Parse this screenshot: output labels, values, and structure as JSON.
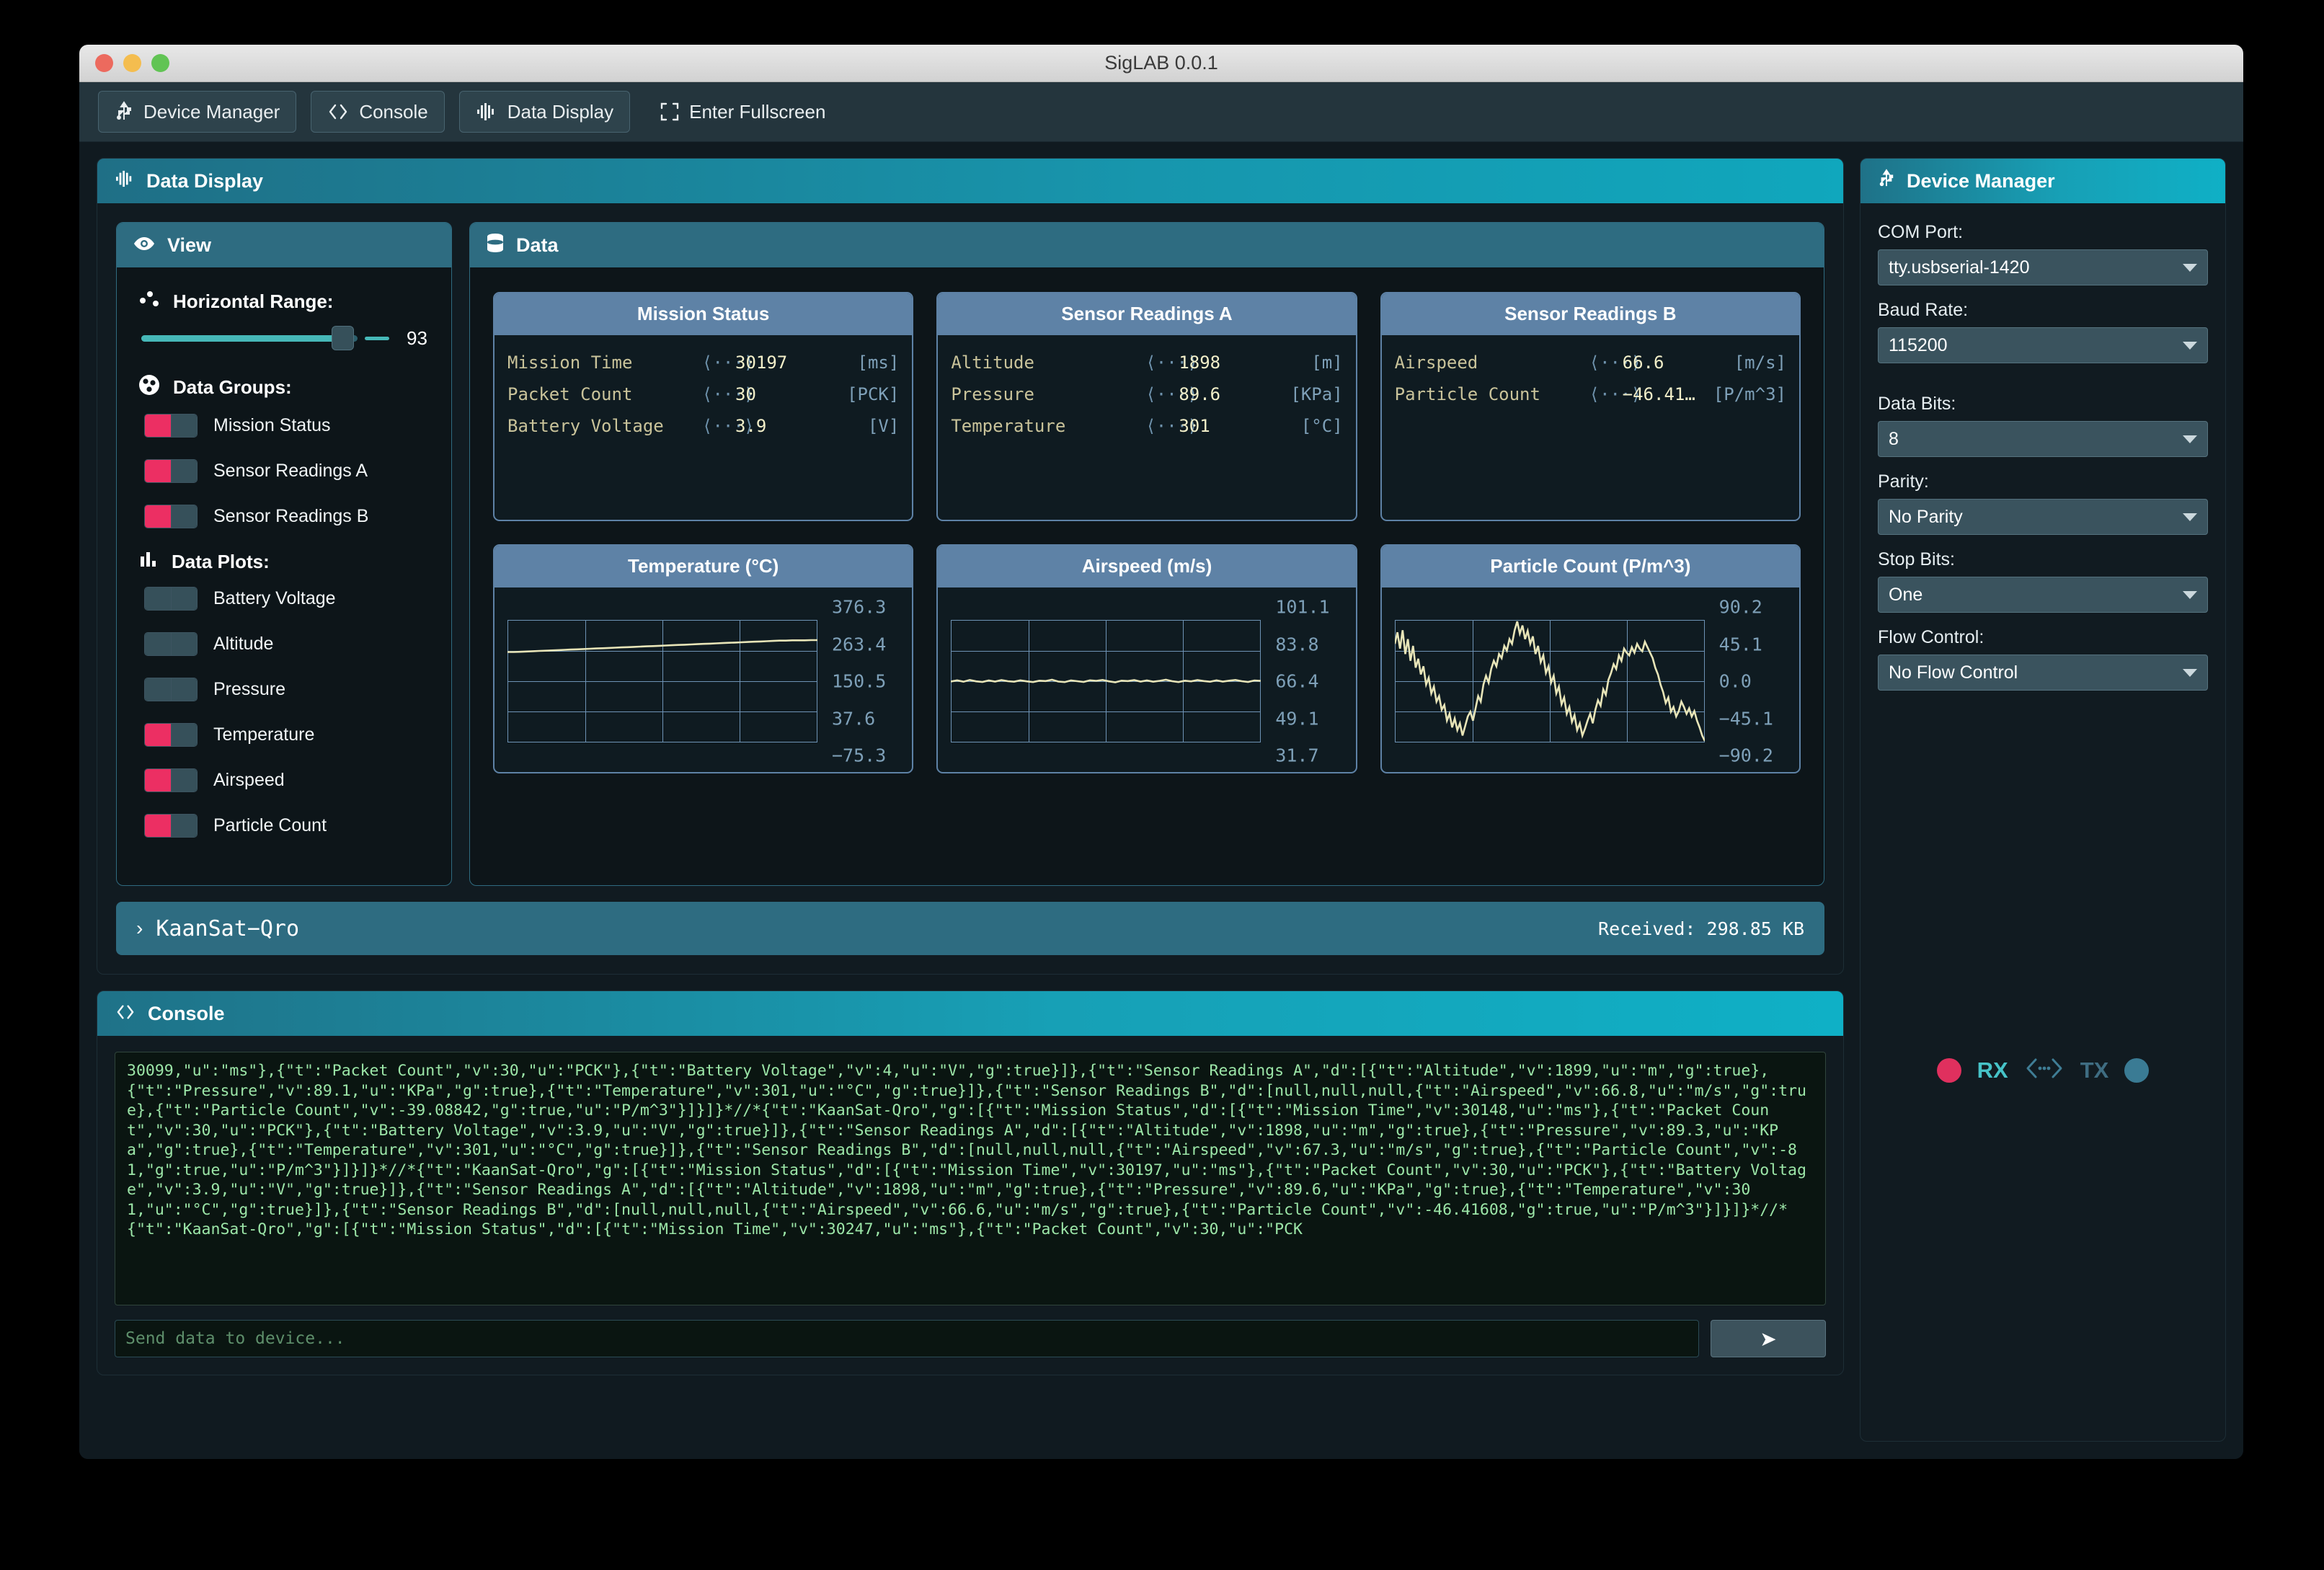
{
  "window": {
    "title": "SigLAB 0.0.1"
  },
  "toolbar": {
    "device_manager": "Device Manager",
    "console": "Console",
    "data_display": "Data Display",
    "fullscreen": "Enter Fullscreen"
  },
  "data_display": {
    "header": "Data Display",
    "view": {
      "header": "View",
      "horizontal_range_label": "Horizontal Range:",
      "horizontal_range_value": "93",
      "data_groups_label": "Data Groups:",
      "groups": [
        {
          "label": "Mission Status",
          "state": "on"
        },
        {
          "label": "Sensor Readings A",
          "state": "on"
        },
        {
          "label": "Sensor Readings B",
          "state": "on"
        }
      ],
      "data_plots_label": "Data Plots:",
      "plots": [
        {
          "label": "Battery Voltage",
          "state": "off"
        },
        {
          "label": "Altitude",
          "state": "off"
        },
        {
          "label": "Pressure",
          "state": "off"
        },
        {
          "label": "Temperature",
          "state": "on"
        },
        {
          "label": "Airspeed",
          "state": "on"
        },
        {
          "label": "Particle Count",
          "state": "on"
        }
      ]
    },
    "data": {
      "header": "Data",
      "cards": [
        {
          "title": "Mission Status",
          "rows": [
            {
              "key": "Mission Time   ",
              "value": "30197",
              "unit": "[ms]"
            },
            {
              "key": "Packet Count   ",
              "value": "30",
              "unit": "[PCK]"
            },
            {
              "key": "Battery Voltage",
              "value": "3.9",
              "unit": "[V]"
            }
          ]
        },
        {
          "title": "Sensor Readings A",
          "rows": [
            {
              "key": "Altitude   ",
              "value": "1898",
              "unit": "[m]"
            },
            {
              "key": "Pressure   ",
              "value": "89.6",
              "unit": "[KPa]"
            },
            {
              "key": "Temperature",
              "value": "301",
              "unit": "[°C]"
            }
          ]
        },
        {
          "title": "Sensor Readings B",
          "rows": [
            {
              "key": "Airspeed      ",
              "value": "66.6",
              "unit": "[m/s]"
            },
            {
              "key": "Particle Count",
              "value": "−46.41…",
              "unit": "[P/m^3]"
            }
          ]
        }
      ]
    }
  },
  "chart_data": [
    {
      "type": "line",
      "title": "Temperature (°C)",
      "ylabel": "",
      "xlabel": "",
      "grid": true,
      "yticks": [
        "376.3",
        "263.4",
        "150.5",
        "37.6",
        "−75.3"
      ],
      "ylim": [
        -75.3,
        376.3
      ],
      "values": [
        258,
        258,
        259,
        260,
        261,
        262,
        263,
        264,
        265,
        266,
        267,
        268,
        269,
        270,
        271,
        272,
        273,
        274,
        275,
        276,
        277,
        278,
        279,
        280,
        281,
        282,
        283,
        284,
        285,
        286,
        287,
        288,
        289,
        290,
        291,
        292,
        293,
        294,
        295,
        296,
        297,
        298,
        299,
        300,
        300,
        301,
        301,
        301,
        302,
        302
      ]
    },
    {
      "type": "line",
      "title": "Airspeed (m/s)",
      "ylabel": "",
      "xlabel": "",
      "grid": true,
      "yticks": [
        "101.1",
        "83.8",
        "66.4",
        "49.1",
        "31.7"
      ],
      "ylim": [
        31.7,
        101.1
      ],
      "values": [
        66.2,
        66.9,
        66.1,
        67.1,
        66.3,
        66.0,
        66.8,
        66.2,
        67.0,
        66.4,
        66.1,
        66.9,
        66.3,
        65.9,
        66.7,
        66.5,
        67.2,
        66.2,
        65.9,
        66.8,
        66.4,
        66.0,
        66.9,
        66.6,
        67.1,
        66.3,
        65.8,
        66.7,
        66.5,
        67.0,
        66.2,
        66.8,
        66.1,
        66.6,
        67.2,
        66.4,
        65.9,
        66.7,
        66.3,
        67.0,
        66.5,
        66.1,
        66.9,
        66.2,
        66.7,
        67.1,
        66.4,
        66.0,
        66.8,
        66.6
      ]
    },
    {
      "type": "line",
      "title": "Particle Count (P/m^3)",
      "ylabel": "",
      "xlabel": "",
      "grid": true,
      "yticks": [
        "90.2",
        "45.1",
        "0.0",
        "−45.1",
        "−90.2"
      ],
      "ylim": [
        -90.2,
        90.2
      ],
      "values": [
        55,
        72,
        48,
        75,
        40,
        62,
        30,
        52,
        20,
        33,
        10,
        22,
        -5,
        5,
        -18,
        -8,
        -30,
        -22,
        -42,
        -35,
        -58,
        -48,
        -68,
        -55,
        -72,
        -62,
        -80,
        -66,
        -52,
        -45,
        -58,
        -40,
        -22,
        -30,
        -5,
        8,
        -2,
        18,
        30,
        22,
        40,
        34,
        52,
        45,
        62,
        55,
        75,
        88,
        70,
        82,
        62,
        74,
        55,
        66,
        40,
        52,
        28,
        38,
        12,
        22,
        -2,
        8,
        -18,
        -8,
        -34,
        -24,
        -48,
        -38,
        -60,
        -50,
        -72,
        -62,
        -80,
        -70,
        -58,
        -48,
        -62,
        -42,
        -28,
        -36,
        -12,
        -20,
        2,
        12,
        25,
        18,
        38,
        30,
        48,
        42,
        38,
        50,
        42,
        55,
        48,
        44,
        58,
        50,
        42,
        34,
        20,
        10,
        -5,
        -16,
        -32,
        -24,
        -45,
        -38,
        -52,
        -44,
        -30,
        -38,
        -48,
        -40,
        -52,
        -44,
        -58,
        -68,
        -80,
        -88
      ]
    }
  ],
  "device_bar": {
    "name": "KaanSat−Qro",
    "received": "Received: 298.85 KB",
    "chevron": "›"
  },
  "console": {
    "header": "Console",
    "output": "30099,\"u\":\"ms\"},{\"t\":\"Packet Count\",\"v\":30,\"u\":\"PCK\"},{\"t\":\"Battery Voltage\",\"v\":4,\"u\":\"V\",\"g\":true}]},{\"t\":\"Sensor Readings A\",\"d\":[{\"t\":\"Altitude\",\"v\":1899,\"u\":\"m\",\"g\":true},{\"t\":\"Pressure\",\"v\":89.1,\"u\":\"KPa\",\"g\":true},{\"t\":\"Temperature\",\"v\":301,\"u\":\"°C\",\"g\":true}]},{\"t\":\"Sensor Readings B\",\"d\":[null,null,null,{\"t\":\"Airspeed\",\"v\":66.8,\"u\":\"m/s\",\"g\":true},{\"t\":\"Particle Count\",\"v\":-39.08842,\"g\":true,\"u\":\"P/m^3\"}]}]}*//*{\"t\":\"KaanSat-Qro\",\"g\":[{\"t\":\"Mission Status\",\"d\":[{\"t\":\"Mission Time\",\"v\":30148,\"u\":\"ms\"},{\"t\":\"Packet Count\",\"v\":30,\"u\":\"PCK\"},{\"t\":\"Battery Voltage\",\"v\":3.9,\"u\":\"V\",\"g\":true}]},{\"t\":\"Sensor Readings A\",\"d\":[{\"t\":\"Altitude\",\"v\":1898,\"u\":\"m\",\"g\":true},{\"t\":\"Pressure\",\"v\":89.3,\"u\":\"KPa\",\"g\":true},{\"t\":\"Temperature\",\"v\":301,\"u\":\"°C\",\"g\":true}]},{\"t\":\"Sensor Readings B\",\"d\":[null,null,null,{\"t\":\"Airspeed\",\"v\":67.3,\"u\":\"m/s\",\"g\":true},{\"t\":\"Particle Count\",\"v\":-81,\"g\":true,\"u\":\"P/m^3\"}]}]}*//*{\"t\":\"KaanSat-Qro\",\"g\":[{\"t\":\"Mission Status\",\"d\":[{\"t\":\"Mission Time\",\"v\":30197,\"u\":\"ms\"},{\"t\":\"Packet Count\",\"v\":30,\"u\":\"PCK\"},{\"t\":\"Battery Voltage\",\"v\":3.9,\"u\":\"V\",\"g\":true}]},{\"t\":\"Sensor Readings A\",\"d\":[{\"t\":\"Altitude\",\"v\":1898,\"u\":\"m\",\"g\":true},{\"t\":\"Pressure\",\"v\":89.6,\"u\":\"KPa\",\"g\":true},{\"t\":\"Temperature\",\"v\":301,\"u\":\"°C\",\"g\":true}]},{\"t\":\"Sensor Readings B\",\"d\":[null,null,null,{\"t\":\"Airspeed\",\"v\":66.6,\"u\":\"m/s\",\"g\":true},{\"t\":\"Particle Count\",\"v\":-46.41608,\"g\":true,\"u\":\"P/m^3\"}]}]}*//*{\"t\":\"KaanSat-Qro\",\"g\":[{\"t\":\"Mission Status\",\"d\":[{\"t\":\"Mission Time\",\"v\":30247,\"u\":\"ms\"},{\"t\":\"Packet Count\",\"v\":30,\"u\":\"PCK",
    "input_placeholder": "Send data to device...",
    "send_icon": "➤"
  },
  "device_manager": {
    "header": "Device Manager",
    "fields": [
      {
        "label": "COM Port:",
        "value": "tty.usbserial-1420"
      },
      {
        "label": "Baud Rate:",
        "value": "115200"
      },
      {
        "label": "Data Bits:",
        "value": "8"
      },
      {
        "label": "Parity:",
        "value": "No Parity"
      },
      {
        "label": "Stop Bits:",
        "value": "One"
      },
      {
        "label": "Flow Control:",
        "value": "No Flow Control"
      }
    ],
    "status": {
      "rx": "RX",
      "tx": "TX"
    }
  },
  "colors": {
    "accent_teal": "#17a0b6",
    "active_pink": "#ec2f63",
    "card_header_blue": "#5e82a6",
    "plot_line": "#e8e5b8",
    "console_text": "#9ce6a8"
  }
}
